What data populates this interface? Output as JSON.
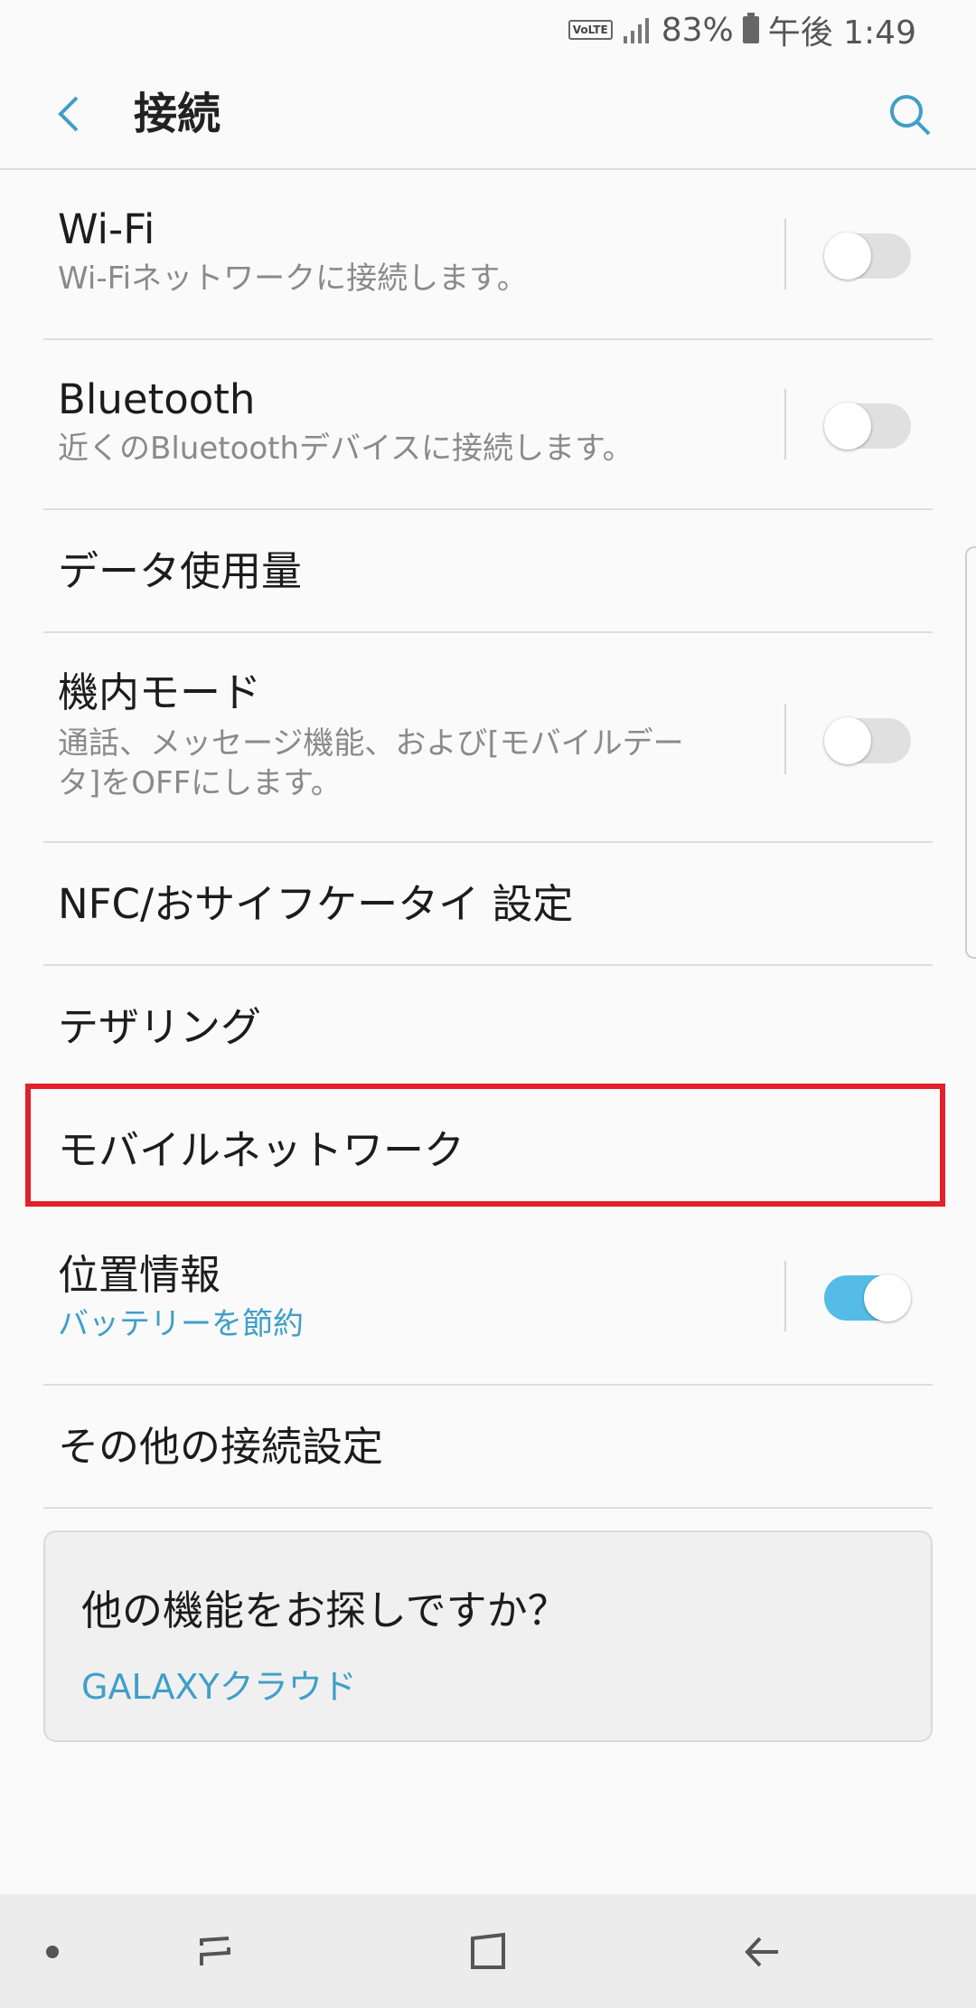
{
  "status_bar": {
    "volte": "VoLTE",
    "battery_percent": "83%",
    "time": "午後 1:49"
  },
  "app_bar": {
    "title": "接続",
    "back_icon": "chevron-left-icon",
    "search_icon": "search-icon"
  },
  "settings": {
    "wifi": {
      "title": "Wi-Fi",
      "subtitle": "Wi-Fiネットワークに接続します。",
      "enabled": false
    },
    "bluetooth": {
      "title": "Bluetooth",
      "subtitle": "近くのBluetoothデバイスに接続します。",
      "enabled": false
    },
    "data_usage": {
      "title": "データ使用量"
    },
    "airplane": {
      "title": "機内モード",
      "subtitle_line1": "通話、メッセージ機能、および[モバイルデー",
      "subtitle_line2": "タ]をOFFにします。",
      "enabled": false
    },
    "nfc": {
      "title": "NFC/おサイフケータイ 設定"
    },
    "tethering": {
      "title": "テザリング"
    },
    "mobile_network": {
      "title": "モバイルネットワーク"
    },
    "location": {
      "title": "位置情報",
      "subtitle": "バッテリーを節約",
      "enabled": true
    },
    "more": {
      "title": "その他の接続設定"
    }
  },
  "card": {
    "title": "他の機能をお探しですか？",
    "link": "GALAXYクラウド"
  },
  "colors": {
    "accent": "#3f9fc9",
    "toggle_on": "#54bce6",
    "highlight": "#e3212b"
  }
}
